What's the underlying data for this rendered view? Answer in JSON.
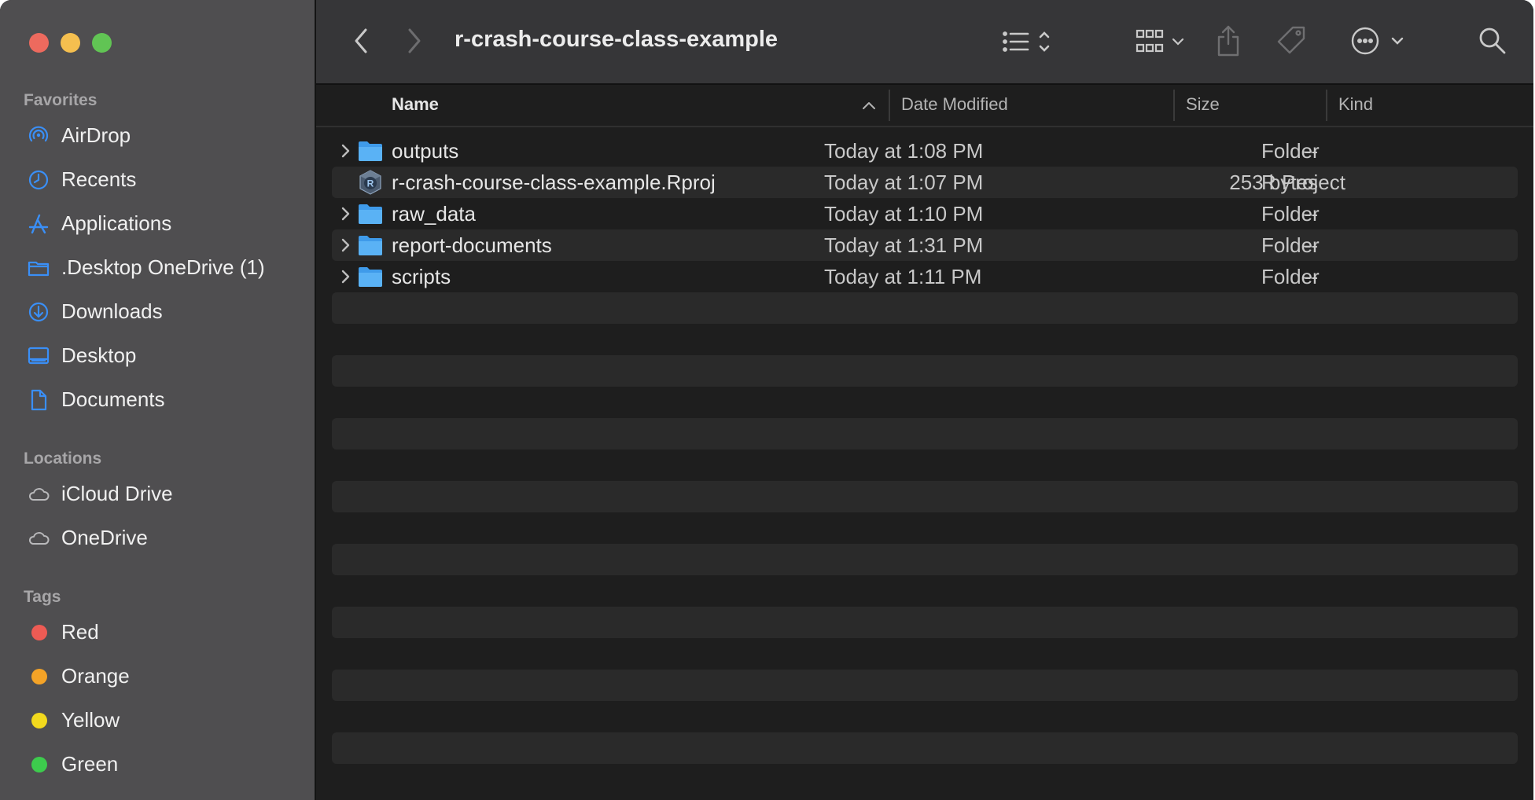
{
  "window": {
    "title": "r-crash-course-class-example"
  },
  "sidebar": {
    "favorites_title": "Favorites",
    "favorites": [
      {
        "label": "AirDrop",
        "icon": "airdrop-icon"
      },
      {
        "label": "Recents",
        "icon": "clock-icon"
      },
      {
        "label": "Applications",
        "icon": "applications-icon"
      },
      {
        "label": ".Desktop OneDrive (1)",
        "icon": "folder-icon"
      },
      {
        "label": "Downloads",
        "icon": "download-icon"
      },
      {
        "label": "Desktop",
        "icon": "desktop-icon"
      },
      {
        "label": "Documents",
        "icon": "document-icon"
      }
    ],
    "locations_title": "Locations",
    "locations": [
      {
        "label": "iCloud Drive",
        "icon": "cloud-icon"
      },
      {
        "label": "OneDrive",
        "icon": "cloud-icon"
      }
    ],
    "tags_title": "Tags",
    "tags": [
      {
        "label": "Red",
        "color": "#ed5b54"
      },
      {
        "label": "Orange",
        "color": "#f4a327"
      },
      {
        "label": "Yellow",
        "color": "#f2d91d"
      },
      {
        "label": "Green",
        "color": "#3dcb4d"
      }
    ]
  },
  "columns": {
    "name": "Name",
    "date": "Date Modified",
    "size": "Size",
    "kind": "Kind"
  },
  "files": [
    {
      "name": "outputs",
      "date": "Today at 1:08 PM",
      "size": "--",
      "kind": "Folder",
      "type": "folder"
    },
    {
      "name": "r-crash-course-class-example.Rproj",
      "date": "Today at 1:07 PM",
      "size": "253 bytes",
      "kind": "R Project",
      "type": "rproj"
    },
    {
      "name": "raw_data",
      "date": "Today at 1:10 PM",
      "size": "--",
      "kind": "Folder",
      "type": "folder"
    },
    {
      "name": "report-documents",
      "date": "Today at 1:31 PM",
      "size": "--",
      "kind": "Folder",
      "type": "folder"
    },
    {
      "name": "scripts",
      "date": "Today at 1:11 PM",
      "size": "--",
      "kind": "Folder",
      "type": "folder"
    }
  ],
  "colors": {
    "accent": "#3a8ff7",
    "folder": "#5ab2f5"
  }
}
